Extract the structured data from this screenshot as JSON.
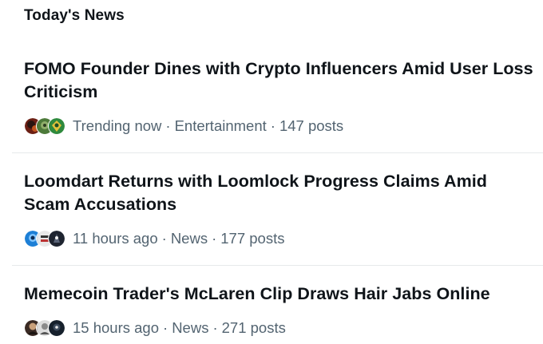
{
  "section": {
    "title": "Today's News"
  },
  "stories": [
    {
      "headline": "FOMO Founder Dines with Crypto Influencers Amid User Loss Criticism",
      "time": "Trending now",
      "category": "Entertainment",
      "posts": "147 posts",
      "avatar_colors": [
        "#6b1f14",
        "#4d7a3a",
        "#2f8a3d"
      ]
    },
    {
      "headline": "Loomdart Returns with Loomlock Progress Claims Amid Scam Accusations",
      "time": "11 hours ago",
      "category": "News",
      "posts": "177 posts",
      "avatar_colors": [
        "#1d7fd6",
        "#e8e8e8",
        "#1e2430"
      ]
    },
    {
      "headline": "Memecoin Trader's McLaren Clip Draws Hair Jabs Online",
      "time": "15 hours ago",
      "category": "News",
      "posts": "271 posts",
      "avatar_colors": [
        "#3a2a24",
        "#dcdcdc",
        "#16202c"
      ]
    }
  ],
  "separator": "·",
  "colors": {
    "text_primary": "#0f1419",
    "text_secondary": "#536471",
    "divider": "#e6e9eb"
  }
}
